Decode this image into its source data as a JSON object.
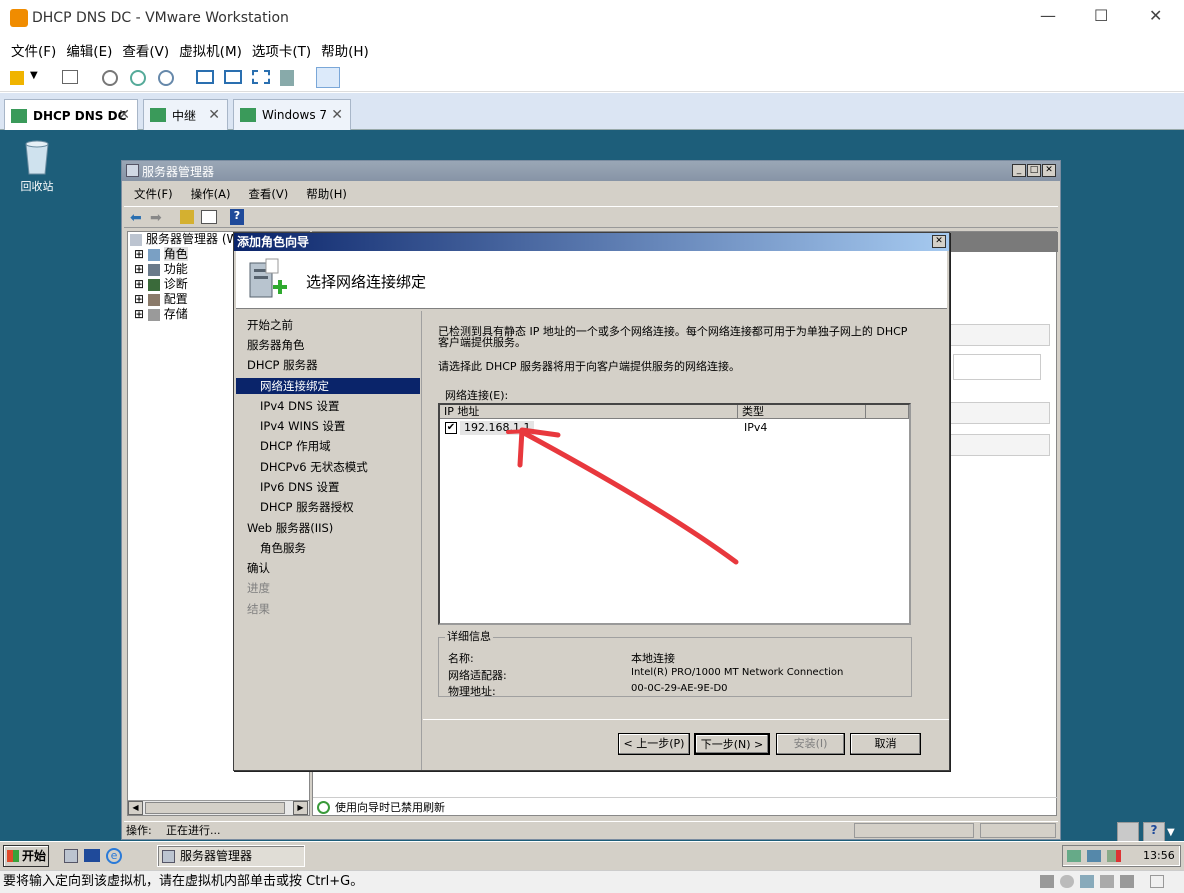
{
  "vmware": {
    "title": "DHCP DNS DC - VMware Workstation",
    "menu": [
      "文件(F)",
      "编辑(E)",
      "查看(V)",
      "虚拟机(M)",
      "选项卡(T)",
      "帮助(H)"
    ],
    "tabs": [
      {
        "label": "DHCP DNS DC",
        "active": true
      },
      {
        "label": "中继",
        "active": false
      },
      {
        "label": "Windows 7",
        "active": false
      }
    ],
    "status_hint": "要将输入定向到该虚拟机，请在虚拟机内部单击或按 Ctrl+G。"
  },
  "desktop": {
    "recycle_bin": "回收站"
  },
  "server_manager": {
    "title": "服务器管理器",
    "menu": [
      "文件(F)",
      "操作(A)",
      "查看(V)",
      "帮助(H)"
    ],
    "tree_root": "服务器管理器 (W",
    "tree_items": [
      "角色",
      "功能",
      "诊断",
      "配置",
      "存储"
    ],
    "refresh_notice": "使用向导时已禁用刷新",
    "status_label": "操作:",
    "status_value": "正在进行..."
  },
  "wizard": {
    "title": "添加角色向导",
    "heading": "选择网络连接绑定",
    "steps": [
      {
        "label": "开始之前",
        "indent": false,
        "state": "normal"
      },
      {
        "label": "服务器角色",
        "indent": false,
        "state": "normal"
      },
      {
        "label": "DHCP 服务器",
        "indent": false,
        "state": "normal"
      },
      {
        "label": "网络连接绑定",
        "indent": true,
        "state": "current"
      },
      {
        "label": "IPv4 DNS 设置",
        "indent": true,
        "state": "normal"
      },
      {
        "label": "IPv4 WINS 设置",
        "indent": true,
        "state": "normal"
      },
      {
        "label": "DHCP 作用域",
        "indent": true,
        "state": "normal"
      },
      {
        "label": "DHCPv6 无状态模式",
        "indent": true,
        "state": "normal"
      },
      {
        "label": "IPv6 DNS 设置",
        "indent": true,
        "state": "normal"
      },
      {
        "label": "DHCP 服务器授权",
        "indent": true,
        "state": "normal"
      },
      {
        "label": "Web 服务器(IIS)",
        "indent": false,
        "state": "normal"
      },
      {
        "label": "角色服务",
        "indent": true,
        "state": "normal"
      },
      {
        "label": "确认",
        "indent": false,
        "state": "normal"
      },
      {
        "label": "进度",
        "indent": false,
        "state": "dim"
      },
      {
        "label": "结果",
        "indent": false,
        "state": "dim"
      }
    ],
    "desc1_line1": "已检测到具有静态 IP 地址的一个或多个网络连接。每个网络连接都可用于为单独子网上的 DHCP",
    "desc1_line2": "客户端提供服务。",
    "desc2": "请选择此 DHCP 服务器将用于向客户端提供服务的网络连接。",
    "list_label": "网络连接(E):",
    "col_ip": "IP 地址",
    "col_type": "类型",
    "row_ip": "192.168.1.1",
    "row_type": "IPv4",
    "row_checked": true,
    "details_title": "详细信息",
    "details_name_label": "名称:",
    "details_name_value": "本地连接",
    "details_adapter_label": "网络适配器:",
    "details_adapter_value": "Intel(R) PRO/1000 MT Network Connection",
    "details_mac_label": "物理地址:",
    "details_mac_value": "00-0C-29-AE-9E-D0",
    "btn_prev": "< 上一步(P)",
    "btn_next": "下一步(N) >",
    "btn_install": "安装(I)",
    "btn_cancel": "取消"
  },
  "taskbar": {
    "start": "开始",
    "task": "服务器管理器",
    "clock": "13:56"
  },
  "colors": {
    "guest_bg": "#1d5e7a",
    "annotation": "#e8383d"
  }
}
